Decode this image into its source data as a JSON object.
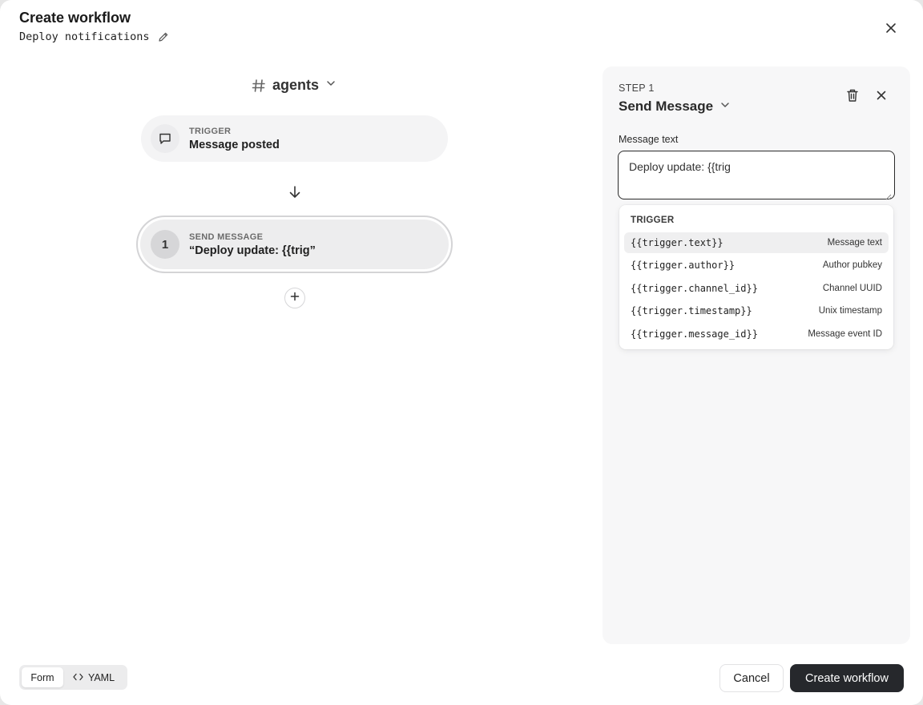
{
  "header": {
    "title": "Create workflow",
    "workflow_name": "Deploy notifications"
  },
  "canvas": {
    "channel": "agents",
    "trigger": {
      "kicker": "TRIGGER",
      "title": "Message posted"
    },
    "step": {
      "number": "1",
      "kicker": "SEND MESSAGE",
      "title": "“Deploy update: {{trig”"
    }
  },
  "panel": {
    "step_label": "STEP 1",
    "step_type": "Send Message",
    "field_label": "Message text",
    "message_value": "Deploy update: {{trig",
    "autocomplete": {
      "heading": "TRIGGER",
      "items": [
        {
          "code": "{{trigger.text}}",
          "desc": "Message text"
        },
        {
          "code": "{{trigger.author}}",
          "desc": "Author pubkey"
        },
        {
          "code": "{{trigger.channel_id}}",
          "desc": "Channel UUID"
        },
        {
          "code": "{{trigger.timestamp}}",
          "desc": "Unix timestamp"
        },
        {
          "code": "{{trigger.message_id}}",
          "desc": "Message event ID"
        }
      ]
    }
  },
  "footer": {
    "mode_form": "Form",
    "mode_yaml": "YAML",
    "cancel": "Cancel",
    "create": "Create workflow"
  },
  "icons": {
    "close": "close-icon",
    "edit": "pencil-icon",
    "channel": "hash-icon",
    "trigger": "message-bubble-icon",
    "arrow": "arrow-down-icon",
    "add": "plus-icon",
    "delete": "trash-icon",
    "code": "code-brackets-icon"
  },
  "colors": {
    "primary_button": "#26282c",
    "panel_bg": "#f7f7f8",
    "node_bg": "#f4f4f5"
  }
}
